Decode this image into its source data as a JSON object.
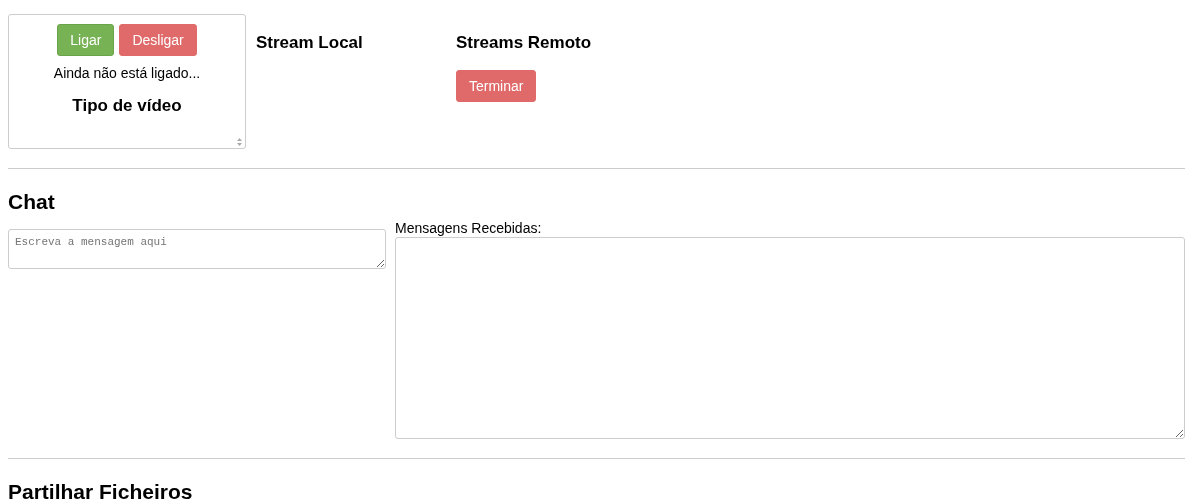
{
  "control_panel": {
    "buttons": [
      {
        "label": "Ligar",
        "kind": "connect",
        "disabled": false
      },
      {
        "label": "Desligar",
        "kind": "disconnect",
        "disabled": true
      }
    ],
    "status": "Ainda não está ligado...",
    "video_type_heading": "Tipo de vídeo"
  },
  "local_stream": {
    "heading": "Stream Local"
  },
  "remote_streams": {
    "heading": "Streams Remoto",
    "button": {
      "label": "Terminar",
      "kind": "disconnect",
      "disabled": true
    }
  },
  "chat": {
    "heading": "Chat",
    "message_field": {
      "placeholder": "Escreva a mensagem aqui"
    },
    "received_label": "Mensagens Recebidas:"
  },
  "file_sharing": {
    "heading": "Partilhar Ficheiros"
  }
}
